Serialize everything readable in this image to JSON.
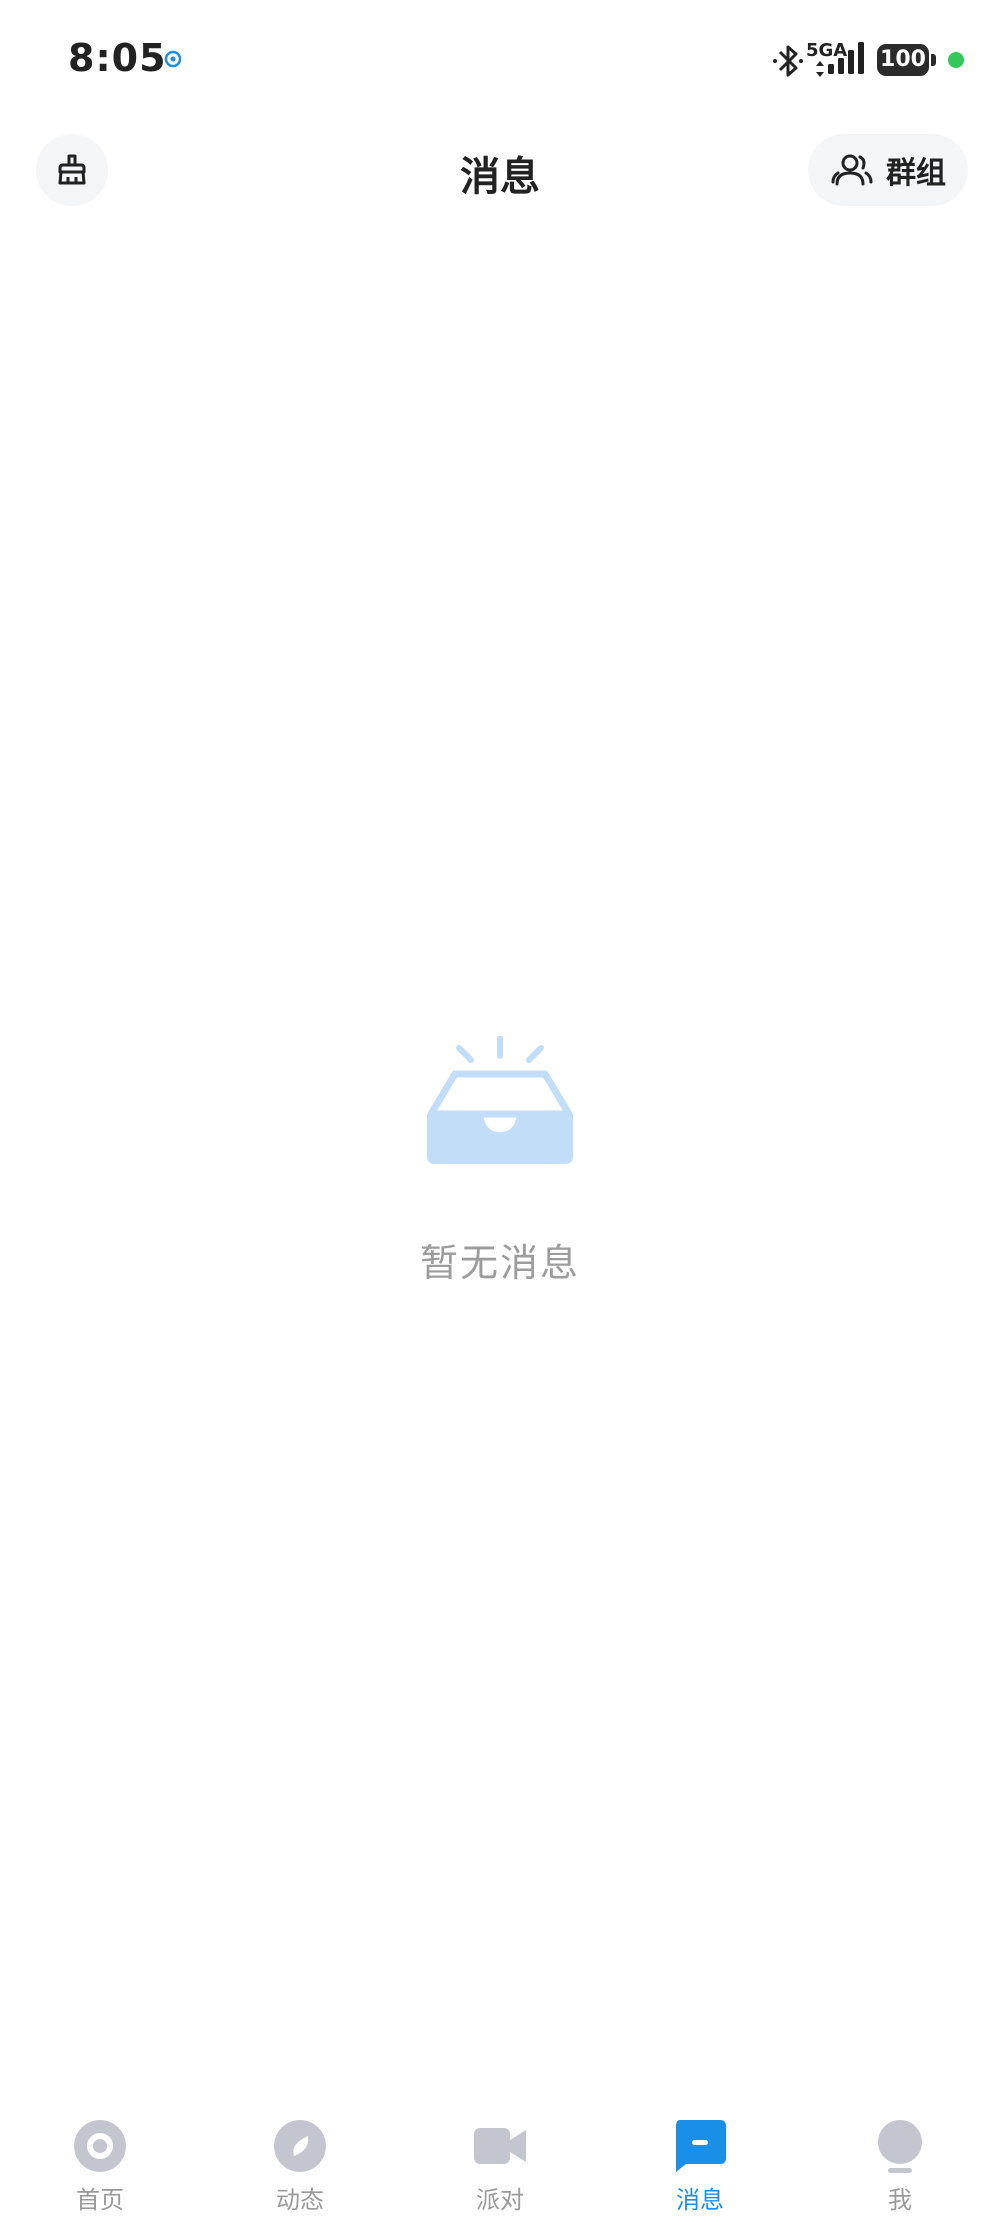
{
  "status_bar": {
    "time": "8:05",
    "network_label": "5GA",
    "battery": "100"
  },
  "header": {
    "title": "消息",
    "group_button_label": "群组",
    "clean_icon": "broom-icon",
    "group_icon": "people-icon"
  },
  "empty_state": {
    "text": "暂无消息",
    "icon": "empty-inbox-icon"
  },
  "tabs": [
    {
      "label": "首页",
      "icon": "home-icon",
      "active": false
    },
    {
      "label": "动态",
      "icon": "compass-icon",
      "active": false
    },
    {
      "label": "派对",
      "icon": "video-icon",
      "active": false
    },
    {
      "label": "消息",
      "icon": "message-icon",
      "active": true
    },
    {
      "label": "我",
      "icon": "profile-icon",
      "active": false
    }
  ],
  "colors": {
    "accent": "#1a8fe8",
    "inactive_icon": "#c3c6cf",
    "empty_illustration": "#c2ddf7",
    "empty_text": "#9c9c9c",
    "status_dot": "#34c759"
  }
}
